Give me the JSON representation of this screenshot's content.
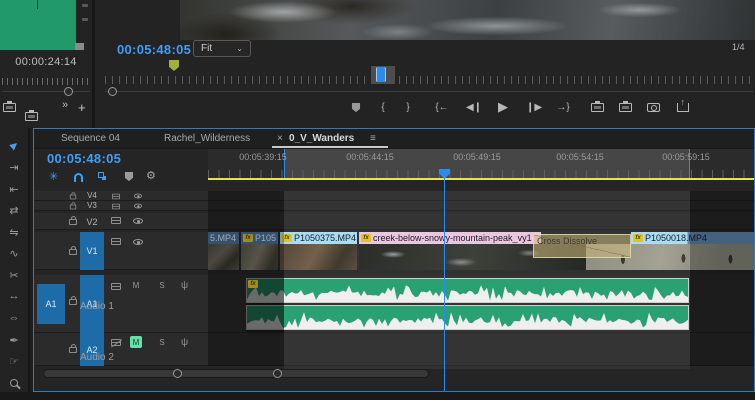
{
  "source_monitor": {
    "timecode": "00:00:24:14",
    "more_label": "»",
    "add_label": "+"
  },
  "program_monitor": {
    "timecode": "00:05:48:05",
    "zoom_select_value": "Fit",
    "zoom_select_chevron": "⌄",
    "playback_resolution": "1/4"
  },
  "transport": {
    "mark_in": "{",
    "mark_out": "}",
    "go_to_in": "{←",
    "step_back": "◀❙",
    "play": "▶",
    "step_forward": "❙▶",
    "go_to_out": "→}"
  },
  "tools": [
    {
      "name": "selection-tool",
      "glyph": "►"
    },
    {
      "name": "track-select-forward-tool",
      "glyph": "⇥"
    },
    {
      "name": "ripple-edit-tool",
      "glyph": "⇤"
    },
    {
      "name": "rolling-edit-tool",
      "glyph": "⇄"
    },
    {
      "name": "rate-stretch-tool",
      "glyph": "⇋"
    },
    {
      "name": "remix-tool",
      "glyph": "∿"
    },
    {
      "name": "razor-tool",
      "glyph": "✂"
    },
    {
      "name": "slip-tool",
      "glyph": "↔"
    },
    {
      "name": "slide-tool",
      "glyph": "⇔"
    },
    {
      "name": "pen-tool",
      "glyph": "✒"
    },
    {
      "name": "hand-tool",
      "glyph": "☞"
    }
  ],
  "timeline": {
    "tabs": [
      {
        "label": "Sequence 04"
      },
      {
        "label": "Rachel_Wilderness"
      },
      {
        "label": "0_V_Wanders"
      }
    ],
    "active_tab_close": "×",
    "panel_menu": "≡",
    "timecode": "00:05:48:05",
    "nest_toggle_glyph": "✳",
    "ruler_labels": [
      "00:05:39:15",
      "00:05:44:15",
      "00:05:49:15",
      "00:05:54:15",
      "00:05:59:15"
    ],
    "video_tracks": [
      {
        "name": "V4"
      },
      {
        "name": "V3"
      },
      {
        "name": "V2"
      },
      {
        "name": "V1",
        "targeted": true
      }
    ],
    "audio_tracks": [
      {
        "source_patch": "A1",
        "name": "A1",
        "label": "Audio 1",
        "mute": "M",
        "solo": "S",
        "muted": false
      },
      {
        "name": "A2",
        "label": "Audio 2",
        "mute": "M",
        "solo": "S",
        "muted": true
      }
    ],
    "clips": [
      {
        "name": "5.MP4"
      },
      {
        "name": "P105",
        "fx": "fx"
      },
      {
        "name": "P1050375.MP4",
        "fx": "fx"
      },
      {
        "name": "creek-below-snowy-mountain-peak_vy1",
        "fx": "fx"
      },
      {
        "name": "P1050018.MP4",
        "fx": "fx"
      }
    ],
    "transition_name": "Cross Dissolve",
    "audio_clip_fx": "fx",
    "colors": {
      "accent_blue": "#3f9ef5",
      "playhead_blue": "#2d8ceb",
      "target_blue": "#1d6ca8",
      "mute_green": "#63e3a5",
      "waveform_green": "#2aa173",
      "marker_olive": "#a0b03a",
      "yellow_bar": "#e8e44a",
      "fx_badge_yellow": "#e2c229"
    }
  }
}
